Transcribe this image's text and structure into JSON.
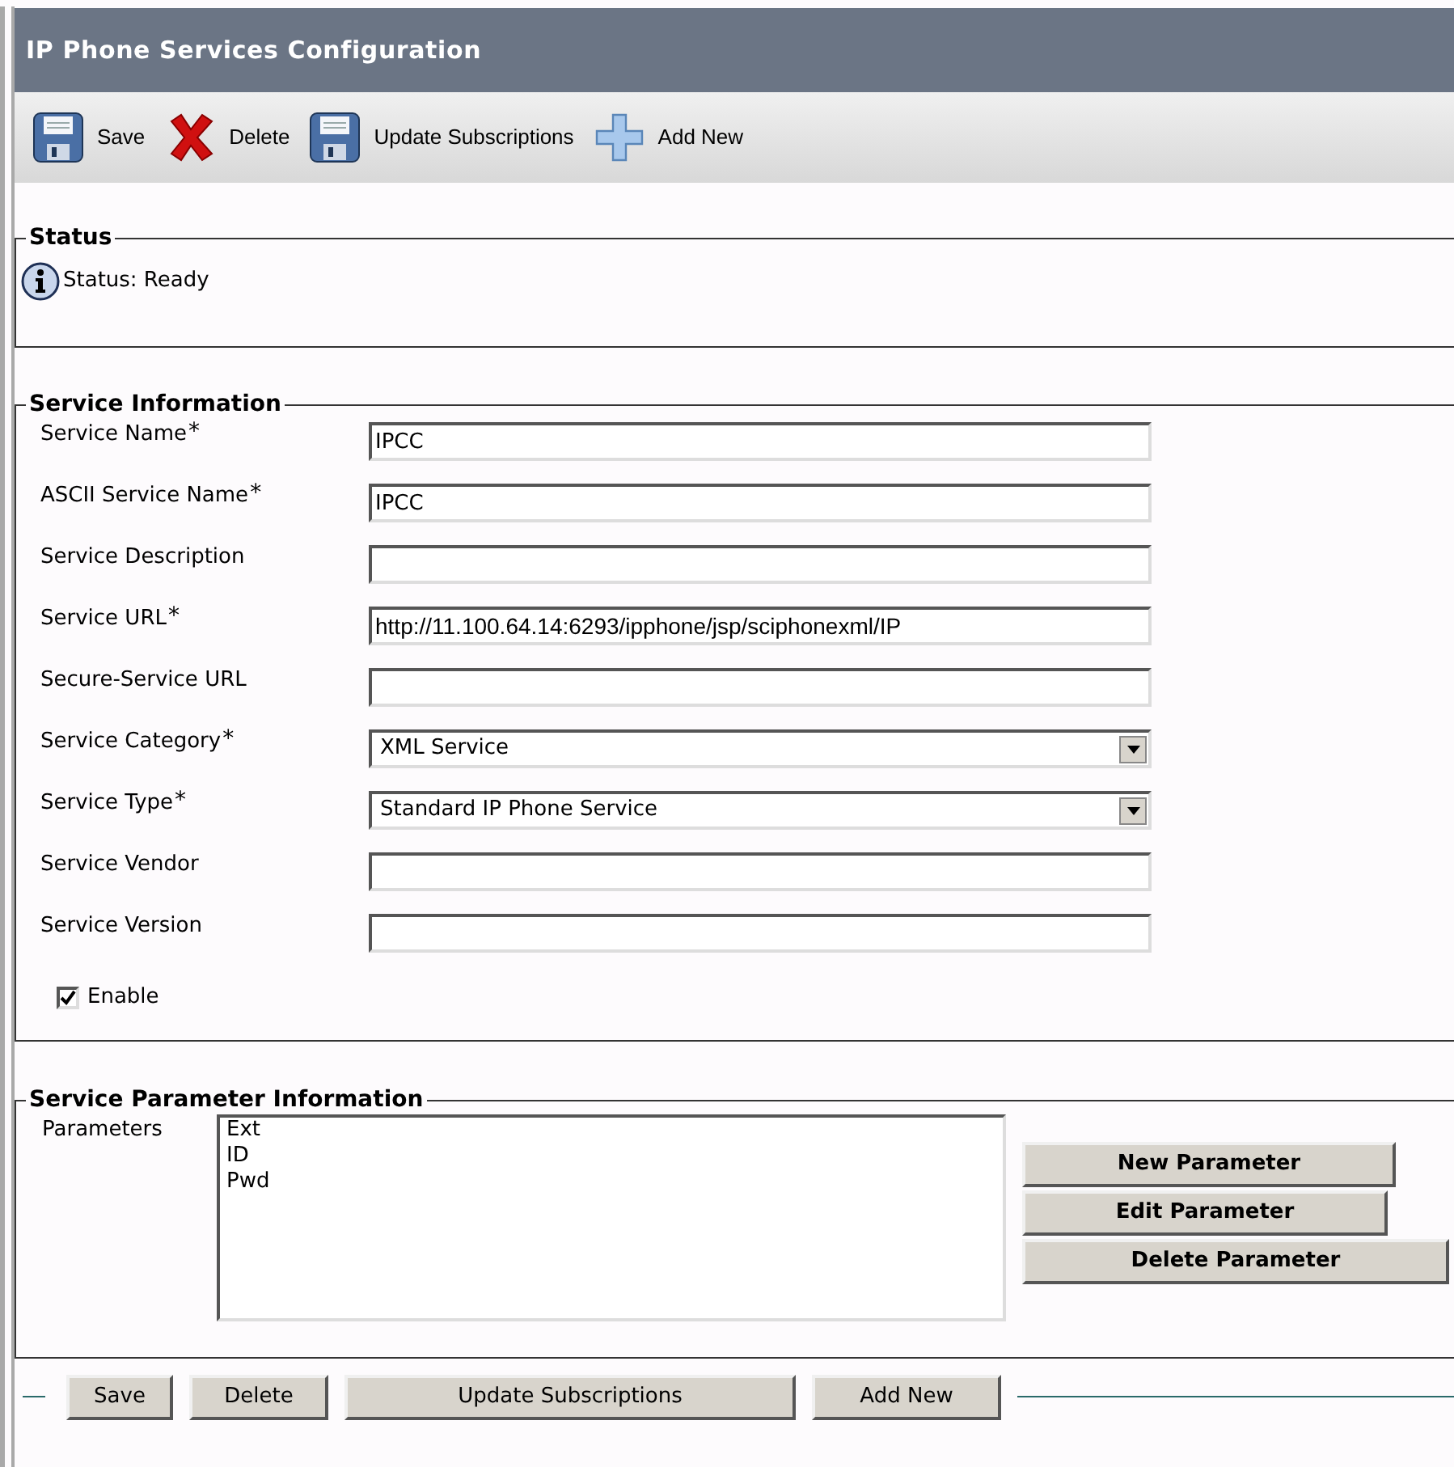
{
  "window": {
    "title": "IP Phone Services Configuration"
  },
  "toolbar": [
    {
      "kind": "save",
      "label": "Save"
    },
    {
      "kind": "delete",
      "label": "Delete"
    },
    {
      "kind": "save",
      "label": "Update Subscriptions"
    },
    {
      "kind": "add",
      "label": "Add New"
    }
  ],
  "status": {
    "legend": "Status",
    "message": "Status: Ready"
  },
  "service_information": {
    "legend": "Service Information",
    "fields": [
      {
        "kind": "text",
        "label": "Service Name",
        "required_mark": "*",
        "value": "IPCC"
      },
      {
        "kind": "text",
        "label": "ASCII Service Name",
        "required_mark": "*",
        "value": "IPCC"
      },
      {
        "kind": "text",
        "label": "Service Description"
      },
      {
        "kind": "text",
        "label": "Service URL",
        "required_mark": "*",
        "value": "http://11.100.64.14:6293/ipphone/jsp/sciphonexml/IP"
      },
      {
        "kind": "text",
        "label": "Secure-Service URL"
      },
      {
        "kind": "select",
        "label": "Service Category",
        "required_mark": "*",
        "value": "XML Service"
      },
      {
        "kind": "select",
        "label": "Service Type",
        "required_mark": "*",
        "value": "Standard IP Phone Service"
      },
      {
        "kind": "text",
        "label": "Service Vendor"
      },
      {
        "kind": "text",
        "label": "Service Version"
      }
    ],
    "enable": {
      "label": "Enable",
      "checked": true
    }
  },
  "service_parameters": {
    "legend": "Service Parameter Information",
    "label": "Parameters",
    "items": [
      "Ext",
      "ID",
      "Pwd"
    ],
    "buttons": [
      "New Parameter",
      "Edit Parameter",
      "Delete Parameter"
    ]
  },
  "bottom_buttons": [
    "Save",
    "Delete",
    "Update Subscriptions",
    "Add New"
  ]
}
